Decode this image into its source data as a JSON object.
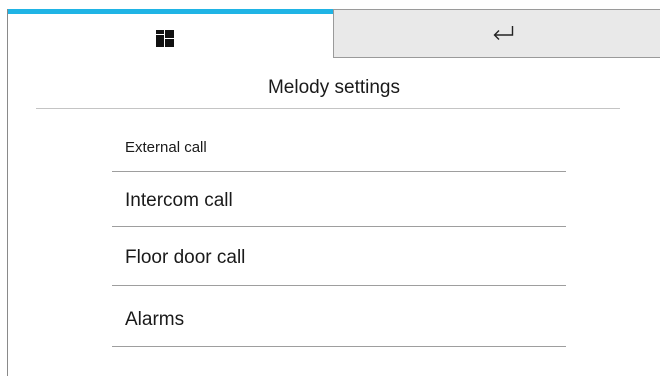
{
  "header": {
    "tabs": [
      {
        "name": "home",
        "icon": "grid-icon",
        "active": true
      },
      {
        "name": "back",
        "icon": "return-arrow-icon",
        "active": false
      }
    ],
    "accent_color": "#1fb4e5",
    "inactive_tab_color": "#e9e9e9"
  },
  "page": {
    "title": "Melody settings"
  },
  "menu": {
    "items": [
      {
        "label": "External call"
      },
      {
        "label": "Intercom call"
      },
      {
        "label": "Floor door call"
      },
      {
        "label": "Alarms"
      }
    ]
  }
}
